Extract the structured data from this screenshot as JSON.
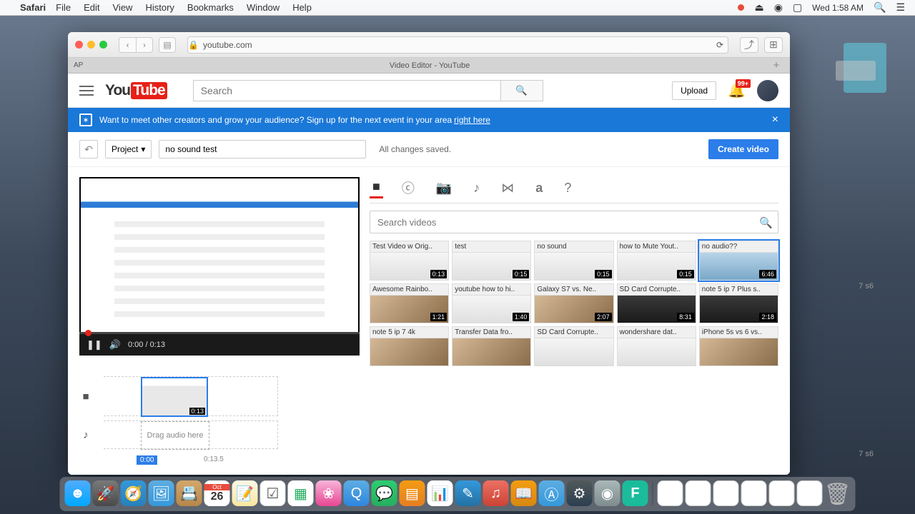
{
  "menubar": {
    "app": "Safari",
    "items": [
      "File",
      "Edit",
      "View",
      "History",
      "Bookmarks",
      "Window",
      "Help"
    ],
    "time": "Wed 1:58 AM"
  },
  "safari": {
    "url": "youtube.com",
    "tab_title": "Video Editor - YouTube",
    "left_tab": "AP"
  },
  "yt": {
    "search_placeholder": "Search",
    "upload": "Upload",
    "badge": "99+"
  },
  "banner": {
    "text": "Want to meet other creators and grow your audience? Sign up for the next event in your area",
    "link": "right here"
  },
  "editor": {
    "project_label": "Project",
    "project_name": "no sound test",
    "saved": "All changes saved.",
    "create": "Create video",
    "time_current": "0:00",
    "time_total": "0:13"
  },
  "library": {
    "search_placeholder": "Search videos",
    "videos": [
      {
        "title": "Test Video w Orig..",
        "dur": "0:13",
        "cls": "light"
      },
      {
        "title": "test",
        "dur": "0:15",
        "cls": "light"
      },
      {
        "title": "no sound",
        "dur": "0:15",
        "cls": "light"
      },
      {
        "title": "how to Mute Yout..",
        "dur": "0:15",
        "cls": "light"
      },
      {
        "title": "no audio??",
        "dur": "6:46",
        "cls": "blue",
        "sel": true
      },
      {
        "title": "Awesome Rainbo..",
        "dur": "1:21",
        "cls": ""
      },
      {
        "title": "youtube how to hi..",
        "dur": "1:40",
        "cls": "light"
      },
      {
        "title": "Galaxy S7 vs. Ne..",
        "dur": "2:07",
        "cls": ""
      },
      {
        "title": "SD Card Corrupte..",
        "dur": "8:31",
        "cls": "dark"
      },
      {
        "title": "note 5 ip 7 Plus s..",
        "dur": "2:18",
        "cls": "dark"
      },
      {
        "title": "note 5 ip 7 4k",
        "dur": "",
        "cls": ""
      },
      {
        "title": "Transfer Data fro..",
        "dur": "",
        "cls": ""
      },
      {
        "title": "SD Card Corrupte..",
        "dur": "",
        "cls": "light"
      },
      {
        "title": "wondershare dat..",
        "dur": "",
        "cls": "light"
      },
      {
        "title": "iPhone 5s vs 6 vs..",
        "dur": "",
        "cls": ""
      }
    ]
  },
  "timeline": {
    "clip_dur": "0:13",
    "audio_hint": "Drag audio here",
    "playhead": "0:00",
    "end": "0:13.5"
  },
  "bg_hint": "7 s6"
}
